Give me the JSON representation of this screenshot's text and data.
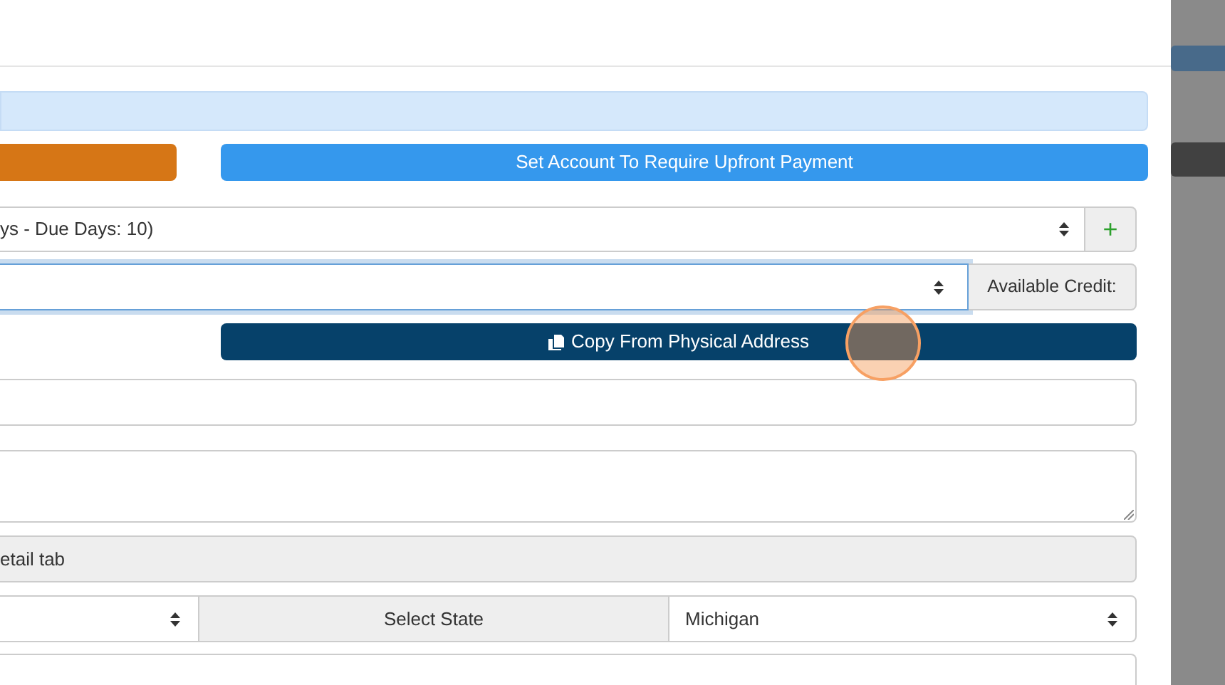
{
  "buttons": [
    {
      "kind": "warning"
    },
    {
      "kind": "primary",
      "label": "Set Account To Require Upfront Payment"
    }
  ],
  "terms_select": {
    "value": "ys - Due Days: 10)",
    "addon": "+"
  },
  "credit_select": {
    "focused": true,
    "addon": "Available Credit:"
  },
  "copy_button": {
    "label": "Copy From Physical Address"
  },
  "readonly_field": {
    "value": "etail tab"
  },
  "state_row": {
    "addon": "Select State",
    "value": "Michigan"
  }
}
